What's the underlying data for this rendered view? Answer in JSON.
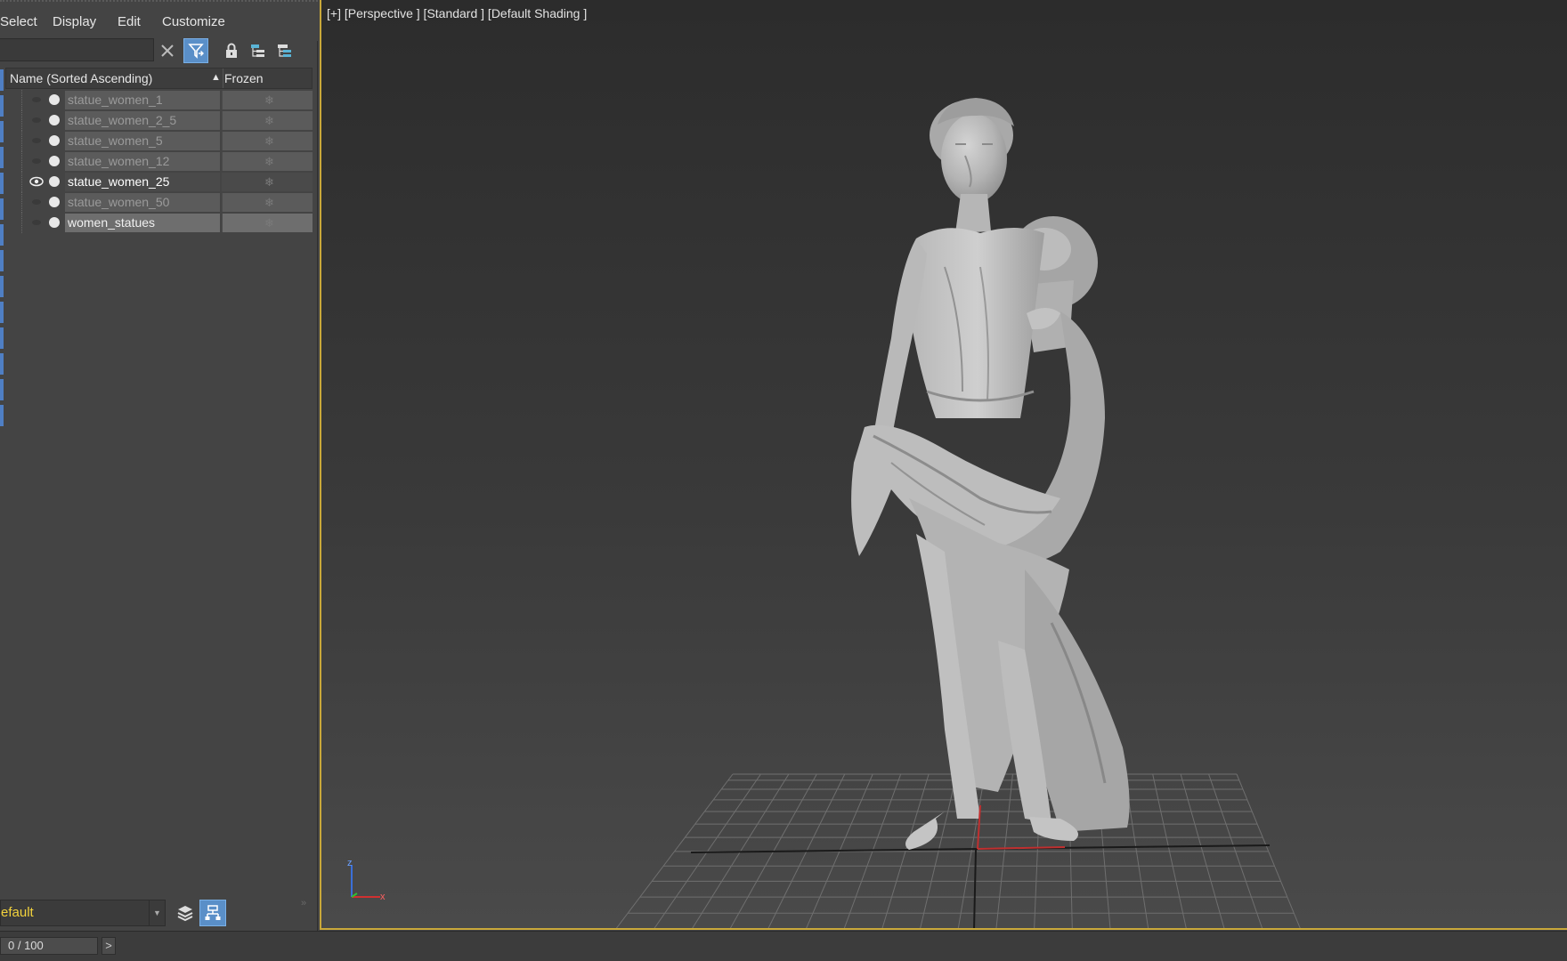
{
  "menu": {
    "items": [
      "Select",
      "Display",
      "Edit",
      "Customize"
    ]
  },
  "toolbar": {
    "search_value": "",
    "icons": [
      "clear-icon",
      "filter-icon",
      "lock-icon",
      "hierarchy-icon",
      "hierarchy-alt-icon"
    ]
  },
  "columns": {
    "name_header": "Name (Sorted Ascending)",
    "sort_indicator": "▲",
    "frozen_header": "Frozen"
  },
  "rows": [
    {
      "name": "statue_women_1",
      "visible": false,
      "state": "normal"
    },
    {
      "name": "statue_women_2_5",
      "visible": false,
      "state": "normal"
    },
    {
      "name": "statue_women_5",
      "visible": false,
      "state": "normal"
    },
    {
      "name": "statue_women_12",
      "visible": false,
      "state": "normal"
    },
    {
      "name": "statue_women_25",
      "visible": true,
      "state": "active"
    },
    {
      "name": "statue_women_50",
      "visible": false,
      "state": "normal"
    },
    {
      "name": "women_statues",
      "visible": false,
      "state": "selected"
    }
  ],
  "layer_bar": {
    "current_layer": "efault",
    "collapse_glyph": "»"
  },
  "viewport": {
    "label": "[+] [Perspective ] [Standard ] [Default Shading ]",
    "axis_labels": {
      "z": "z",
      "x": "x"
    },
    "border_color": "#c9a83a"
  },
  "timeline": {
    "frame": "0 / 100",
    "next_label": ">"
  },
  "colors": {
    "accent": "#5a8fc8",
    "layer_text": "#f2d23c",
    "viewport_active_border": "#c9a83a"
  }
}
